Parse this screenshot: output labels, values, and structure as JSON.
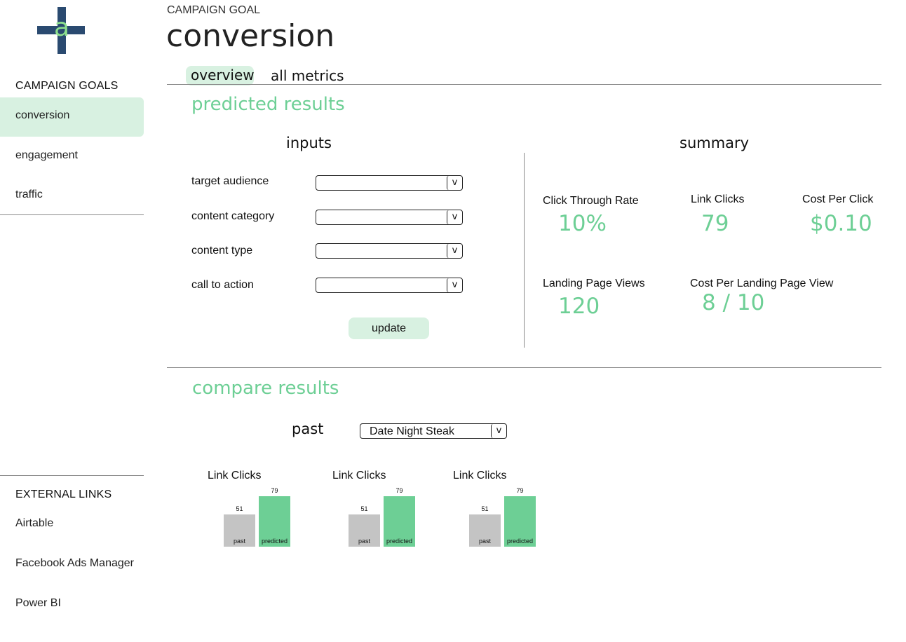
{
  "logo": {
    "letter": "a",
    "cross_color": "#2a4a70",
    "letter_color": "#8ee08e"
  },
  "sidebar": {
    "goals_heading": "CAMPAIGN GOALS",
    "goals": [
      {
        "label": "conversion",
        "active": true
      },
      {
        "label": "engagement",
        "active": false
      },
      {
        "label": "traffic",
        "active": false
      }
    ],
    "links_heading": "EXTERNAL LINKS",
    "links": [
      {
        "label": "Airtable"
      },
      {
        "label": "Facebook Ads Manager"
      },
      {
        "label": "Power BI"
      }
    ]
  },
  "header": {
    "eyebrow": "CAMPAIGN GOAL",
    "title": "conversion"
  },
  "tabs": [
    {
      "label": "overview",
      "active": true
    },
    {
      "label": "all metrics",
      "active": false
    }
  ],
  "predicted": {
    "title": "predicted results",
    "inputs_title": "inputs",
    "inputs": [
      {
        "label": "target audience",
        "value": "",
        "caret": "v"
      },
      {
        "label": "content category",
        "value": "",
        "caret": "v"
      },
      {
        "label": "content type",
        "value": "",
        "caret": "v"
      },
      {
        "label": "call to action",
        "value": "",
        "caret": "v"
      }
    ],
    "update_label": "update",
    "summary_title": "summary",
    "metrics": [
      {
        "label": "Click Through Rate",
        "value": "10%"
      },
      {
        "label": "Link Clicks",
        "value": "79"
      },
      {
        "label": "Cost Per Click",
        "value": "$0.10"
      },
      {
        "label": "Landing Page Views",
        "value": "120"
      },
      {
        "label": "Cost Per Landing Page View",
        "value": "8 / 10"
      }
    ]
  },
  "compare": {
    "title": "compare results",
    "past_label": "past",
    "past_select": {
      "value": "Date Night Steak",
      "caret": "v"
    },
    "charts": [
      {
        "title": "Link Clicks",
        "bars": [
          {
            "label": "past",
            "value": 51
          },
          {
            "label": "predicted",
            "value": 79
          }
        ]
      },
      {
        "title": "Link Clicks",
        "bars": [
          {
            "label": "past",
            "value": 51
          },
          {
            "label": "predicted",
            "value": 79
          }
        ]
      },
      {
        "title": "Link Clicks",
        "bars": [
          {
            "label": "past",
            "value": 51
          },
          {
            "label": "predicted",
            "value": 79
          }
        ]
      }
    ]
  },
  "colors": {
    "accent": "#6dcf95",
    "accent_light": "#d8f1e1",
    "bar_past": "#c4c4c4"
  }
}
